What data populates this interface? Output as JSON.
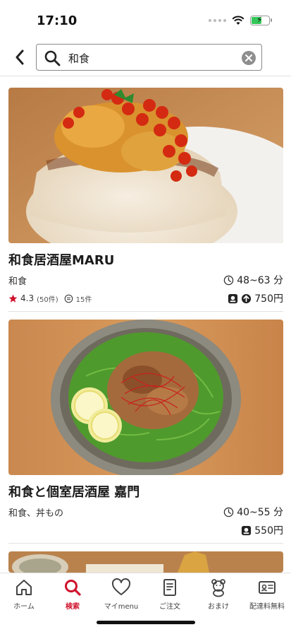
{
  "status_bar": {
    "time": "17:10"
  },
  "search": {
    "query": "和食"
  },
  "restaurants": [
    {
      "name": "和食居酒屋MARU",
      "genre": "和食",
      "delivery_time": "48~63 分",
      "rating": "4.3",
      "reviews": "(50件)",
      "comments": "15件",
      "fee": "750円"
    },
    {
      "name": "和食と個室居酒屋 嘉門",
      "genre": "和食、丼もの",
      "delivery_time": "40~55 分",
      "fee": "550円"
    }
  ],
  "tabs": [
    {
      "label": "ホーム",
      "icon": "home-icon"
    },
    {
      "label": "検索",
      "icon": "search-icon",
      "active": true
    },
    {
      "label": "マイmenu",
      "icon": "heart-icon"
    },
    {
      "label": "ご注文",
      "icon": "receipt-icon"
    },
    {
      "label": "おまけ",
      "icon": "bear-icon"
    },
    {
      "label": "配達料無料",
      "icon": "card-icon"
    }
  ],
  "colors": {
    "accent": "#d0112b",
    "star": "#d0112b"
  }
}
